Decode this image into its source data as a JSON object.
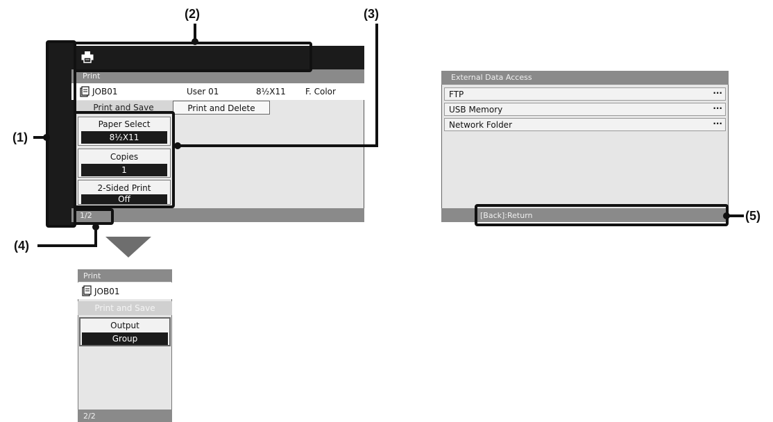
{
  "callouts": {
    "c1": "(1)",
    "c2": "(2)",
    "c3": "(3)",
    "c4": "(4)",
    "c5": "(5)"
  },
  "screen1": {
    "header": "Print",
    "job": {
      "name": "JOB01",
      "user": "User 01",
      "paper": "8½X11",
      "color": "F. Color"
    },
    "tabs": [
      "Print and Save",
      "Print and Delete"
    ],
    "settings": [
      {
        "label": "Paper Select",
        "value": "8½X11"
      },
      {
        "label": "Copies",
        "value": "1"
      },
      {
        "label": "2-Sided Print",
        "value": "Off"
      }
    ],
    "page": "1/2"
  },
  "screen2": {
    "header": "Print",
    "job_name": "JOB01",
    "tab": "Print and Save",
    "setting": {
      "label": "Output",
      "value": "Group"
    },
    "page": "2/2"
  },
  "screen3": {
    "header": "External Data Access",
    "items": [
      {
        "label": "FTP",
        "more": "···"
      },
      {
        "label": "USB Memory",
        "more": "···"
      },
      {
        "label": "Network Folder",
        "more": "···"
      }
    ],
    "footer": "[Back]:Return"
  },
  "icons": {
    "printer": "printer-icon",
    "job": "job-document-icon",
    "arrow": "down-arrow-icon"
  }
}
